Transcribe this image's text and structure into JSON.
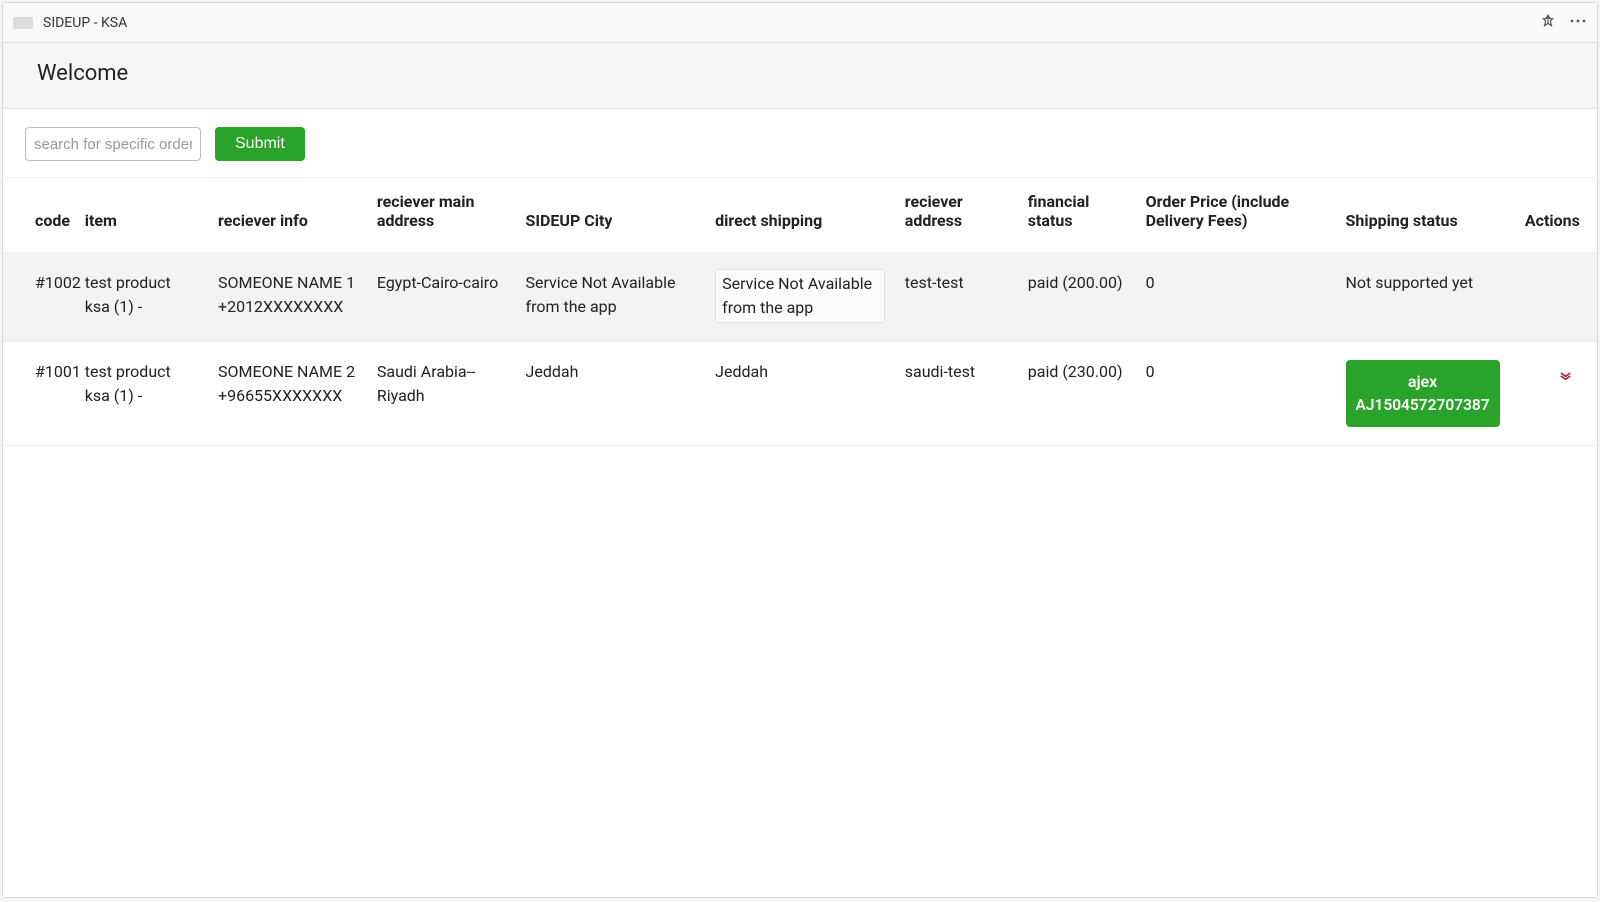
{
  "header": {
    "app_title": "SIDEUP - KSA"
  },
  "welcome": {
    "title": "Welcome"
  },
  "toolbar": {
    "search_placeholder": "search for specific order",
    "search_value": "",
    "submit_label": "Submit"
  },
  "table": {
    "columns": {
      "code": "code",
      "item": "item",
      "reciever_info": "reciever info",
      "reciever_main_address": "reciever main address",
      "sideup_city": "SIDEUP City",
      "direct_shipping": "direct shipping",
      "reciever_address": "reciever address",
      "financial_status": "financial status",
      "order_price": "Order Price (include Delivery Fees)",
      "shipping_status": "Shipping status",
      "actions": "Actions"
    },
    "rows": [
      {
        "code": "#1002",
        "item": "test product ksa (1) -",
        "reciever_info": "SOMEONE NAME 1 +2012XXXXXXXX",
        "reciever_main_address": "Egypt-Cairo-cairo",
        "sideup_city": "Service Not Available from the app",
        "direct_shipping": "Service Not Available from the app",
        "reciever_address": "test-test",
        "financial_status": "paid (200.00)",
        "order_price": "0",
        "shipping_status_text": "Not supported yet",
        "shipping_status_type": "text"
      },
      {
        "code": "#1001",
        "item": "test product ksa (1) -",
        "reciever_info": "SOMEONE NAME 2 +96655XXXXXXX",
        "reciever_main_address": "Saudi Arabia--Riyadh",
        "sideup_city": "Jeddah",
        "direct_shipping": "Jeddah",
        "reciever_address": "saudi-test",
        "financial_status": "paid (230.00)",
        "order_price": "0",
        "shipping_status_type": "badge",
        "shipping_status_line1": "ajex",
        "shipping_status_line2": "AJ1504572707387"
      }
    ]
  }
}
